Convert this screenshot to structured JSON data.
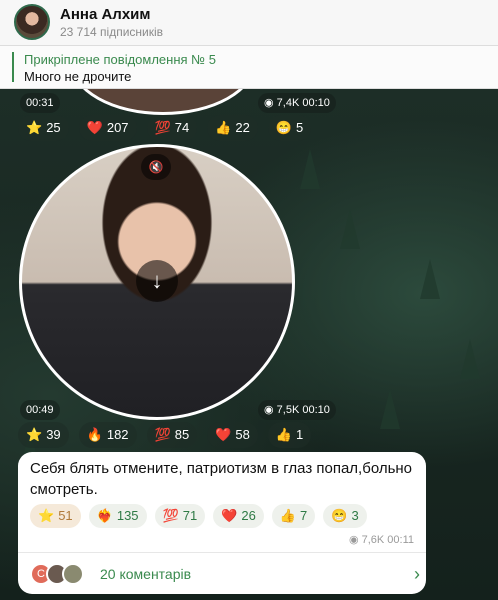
{
  "header": {
    "channel_name": "Анна Алхим",
    "subscribers": "23 714 підписників"
  },
  "pinned": {
    "title": "Прикріплене повідомлення № 5",
    "text": "Много не дрочите"
  },
  "post1": {
    "duration": "00:31",
    "meta": "7,4K 00:10",
    "reactions": [
      {
        "icon": "⭐",
        "count": "25"
      },
      {
        "icon": "❤️",
        "count": "207"
      },
      {
        "icon": "💯",
        "count": "74"
      },
      {
        "icon": "👍",
        "count": "22"
      },
      {
        "icon": "😁",
        "count": "5"
      }
    ]
  },
  "post2": {
    "mute_icon": "🔇",
    "download_icon": "↓",
    "duration": "00:49",
    "meta": "7,5K 00:10",
    "reactions": [
      {
        "icon": "⭐",
        "count": "39"
      },
      {
        "icon": "🔥",
        "count": "182"
      },
      {
        "icon": "💯",
        "count": "85"
      },
      {
        "icon": "❤️",
        "count": "58"
      },
      {
        "icon": "👍",
        "count": "1"
      }
    ]
  },
  "post3": {
    "text": "Себя блять отмените, патриотизм в глаз попал,больно смотреть.",
    "meta": "7,6K 00:11",
    "reactions": [
      {
        "icon": "⭐",
        "count": "51"
      },
      {
        "icon": "❤️‍🔥",
        "count": "135"
      },
      {
        "icon": "💯",
        "count": "71"
      },
      {
        "icon": "❤️",
        "count": "26"
      },
      {
        "icon": "👍",
        "count": "7"
      },
      {
        "icon": "😁",
        "count": "3"
      }
    ],
    "comments": "20 коментарів",
    "comment_avatar_letter": "С"
  }
}
